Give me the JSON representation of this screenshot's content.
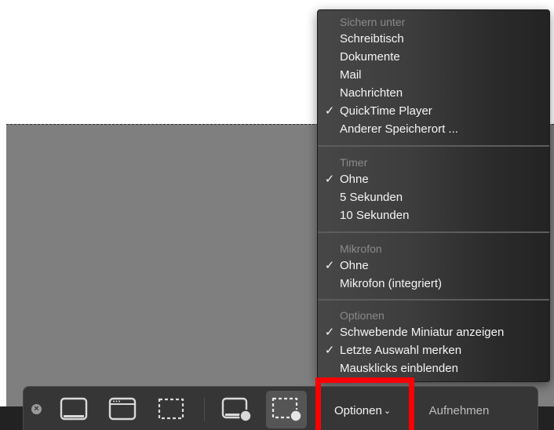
{
  "menu": {
    "save_section": {
      "header": "Sichern unter",
      "items": [
        {
          "label": "Schreibtisch",
          "checked": false
        },
        {
          "label": "Dokumente",
          "checked": false
        },
        {
          "label": "Mail",
          "checked": false
        },
        {
          "label": "Nachrichten",
          "checked": false
        },
        {
          "label": "QuickTime Player",
          "checked": true
        },
        {
          "label": "Anderer Speicherort ...",
          "checked": false
        }
      ]
    },
    "timer_section": {
      "header": "Timer",
      "items": [
        {
          "label": "Ohne",
          "checked": true
        },
        {
          "label": "5 Sekunden",
          "checked": false
        },
        {
          "label": "10 Sekunden",
          "checked": false
        }
      ]
    },
    "mic_section": {
      "header": "Mikrofon",
      "items": [
        {
          "label": "Ohne",
          "checked": true
        },
        {
          "label": "Mikrofon (integriert)",
          "checked": false
        }
      ]
    },
    "options_section": {
      "header": "Optionen",
      "items": [
        {
          "label": "Schwebende Miniatur anzeigen",
          "checked": true
        },
        {
          "label": "Letzte Auswahl merken",
          "checked": true
        },
        {
          "label": "Mausklicks einblenden",
          "checked": false
        }
      ]
    },
    "check_glyph": "✓"
  },
  "toolbar": {
    "close_glyph": "×",
    "icons": [
      "capture-entire-screen-icon",
      "capture-window-icon",
      "capture-selection-icon",
      "record-entire-screen-icon",
      "record-selection-icon"
    ],
    "selected_tool": "record-selection-icon",
    "options_label": "Optionen",
    "options_chevron": "⌄",
    "record_label": "Aufnehmen",
    "highlight_color": "#ff0000"
  }
}
